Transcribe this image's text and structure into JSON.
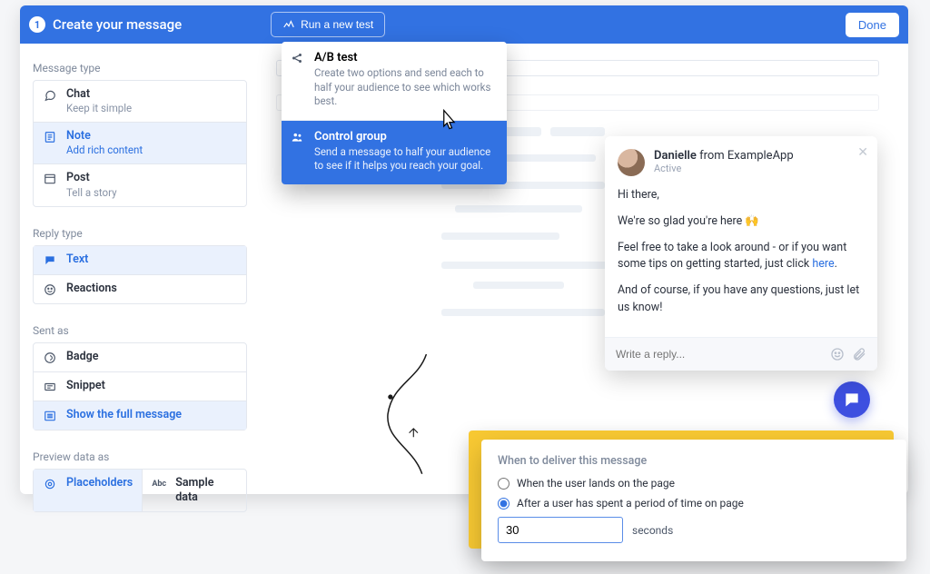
{
  "header": {
    "step": "1",
    "title": "Create your message",
    "run_test_label": "Run a new test",
    "done_label": "Done"
  },
  "sidebar": {
    "message_type_label": "Message type",
    "message_types": [
      {
        "title": "Chat",
        "sub": "Keep it simple"
      },
      {
        "title": "Note",
        "sub": "Add rich content"
      },
      {
        "title": "Post",
        "sub": "Tell a story"
      }
    ],
    "reply_type_label": "Reply type",
    "reply_types": [
      {
        "title": "Text"
      },
      {
        "title": "Reactions"
      }
    ],
    "sent_as_label": "Sent as",
    "sent_as": [
      {
        "title": "Badge"
      },
      {
        "title": "Snippet"
      },
      {
        "title": "Show the full message"
      }
    ],
    "preview_label": "Preview data as",
    "preview": [
      {
        "title": "Placeholders"
      },
      {
        "title": "Sample data"
      }
    ]
  },
  "dropdown": {
    "items": [
      {
        "title": "A/B test",
        "desc": "Create two options and send each to half your audience to see which works best."
      },
      {
        "title": "Control group",
        "desc": "Send a message to half your audience to see if it helps you reach your goal."
      }
    ]
  },
  "chat": {
    "name": "Danielle",
    "from": " from ExampleApp",
    "status": "Active",
    "p1": "Hi there,",
    "p2_a": "We're so glad you're here ",
    "p2_emoji": "🙌",
    "p3_a": "Feel free to take a look around - or if you want some tips on getting started, just click ",
    "p3_link": "here",
    "p3_b": ".",
    "p4": "And of course, if you have any questions, just let us know!",
    "reply_placeholder": "Write a reply..."
  },
  "deliver": {
    "heading": "When to deliver this message",
    "opt1": "When the user lands on the page",
    "opt2": "After a user has spent a period of time on page",
    "value": "30",
    "unit": "seconds"
  }
}
